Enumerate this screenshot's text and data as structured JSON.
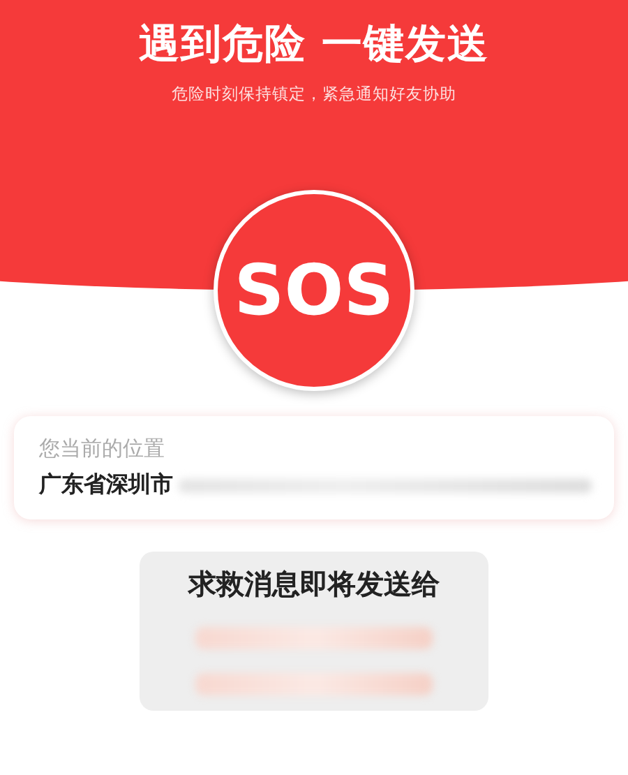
{
  "header": {
    "title": "遇到危险 一键发送",
    "subtitle": "危险时刻保持镇定，紧急通知好友协助"
  },
  "sos_button": {
    "label": "SOS"
  },
  "location": {
    "label": "您当前的位置",
    "address": "广东省深圳市",
    "address_blurred": true
  },
  "recipients": {
    "title": "求救消息即将发送给",
    "entries": [
      {
        "kind": "blurred"
      },
      {
        "kind": "blurred"
      }
    ]
  }
}
